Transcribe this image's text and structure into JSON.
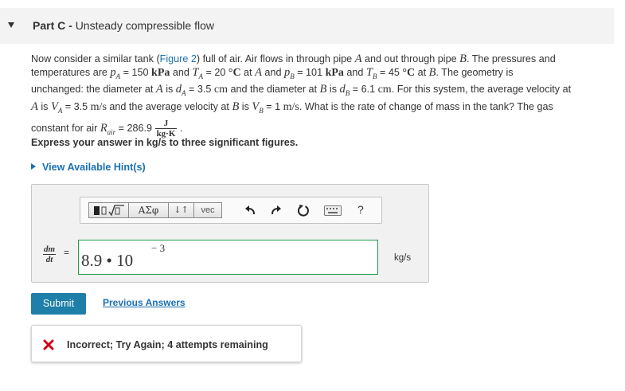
{
  "part": {
    "label": "Part C",
    "separator": " - ",
    "title": "Unsteady compressible flow"
  },
  "problem": {
    "line1_a": "Now consider a similar tank (",
    "figure_link": "Figure 2",
    "line1_b": ") full of air. Air flows in through pipe ",
    "line1_c": " and out through pipe ",
    "line1_d": ". The pressures and",
    "line2_a": "temperatures are ",
    "pA_val": " = 150 ",
    "kPa": "kPa",
    "and": " and ",
    "TA_val": " = 20 ",
    "degC": "°C",
    "line2_b": " at ",
    "line2_c": " and ",
    "pB_val": " = 101 ",
    "TB_val": " = 45 ",
    "line2_d": ". The geometry is",
    "line3_a": "unchanged: the diameter at ",
    "is": " is ",
    "dA_val": " = 3.5 ",
    "cm": "cm",
    "line3_b": " and the diameter at ",
    "dB_val": " = 6.1 ",
    "line3_c": ". For this system, the average velocity at",
    "VA_val": " = 3.5 ",
    "m_s": "m/s",
    "line4_b": " and the average velocity at ",
    "VB_val": " = 1 ",
    "line4_c": ". What is the rate of change of mass in the tank? The gas",
    "line5_a": "constant for air ",
    "R_val": " = 286.9 ",
    "frac_num": "J",
    "frac_den": "kg·K",
    "period": "."
  },
  "instruction": "Express your answer in kg/s to three significant figures.",
  "hints": "View Available Hint(s)",
  "toolbar": {
    "templates_icon": "templates-icon",
    "greek_label": "ΑΣφ",
    "arrows_label": "↓↑",
    "vec_label": "vec",
    "undo_icon": "undo-icon",
    "redo_icon": "redo-icon",
    "reset_icon": "reset-icon",
    "keyboard_icon": "keyboard-icon",
    "help_label": "?"
  },
  "answer": {
    "lhs_num": "dm",
    "lhs_den": "dt",
    "equals": "=",
    "value": "8.9 • 10",
    "exponent": "− 3",
    "units": "kg/s"
  },
  "submit_label": "Submit",
  "previous_answers_label": "Previous Answers",
  "feedback": {
    "icon": "incorrect-x-icon",
    "message": "Incorrect; Try Again; 4 attempts remaining",
    "color": "#d0021b"
  },
  "colors": {
    "link": "#1a6fb3",
    "submit_bg": "#1e7fa8",
    "input_border": "#229b4d"
  }
}
